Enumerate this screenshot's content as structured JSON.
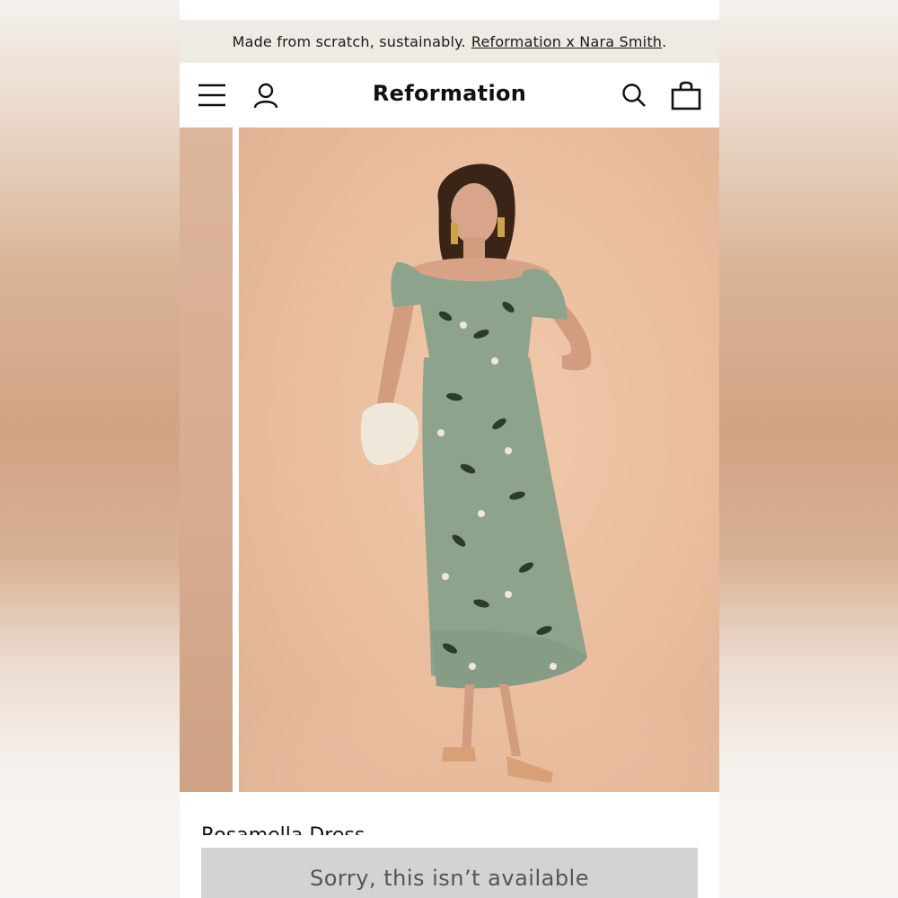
{
  "promo": {
    "text": "Made from scratch, sustainably.",
    "link": "Reformation x Nara Smith",
    "trailing": "."
  },
  "header": {
    "logo": "Reformation",
    "icons": [
      "menu-icon",
      "account-icon",
      "search-icon",
      "bag-icon"
    ]
  },
  "gallery": {
    "image_alt": "Model wearing green floral off-shoulder midi dress"
  },
  "product": {
    "title_partial": "Rosamella Dress"
  },
  "cta": {
    "label": "Sorry, this isn’t available"
  },
  "colors": {
    "promo_bg": "#eeebe4",
    "slide_bg": "#e9bd9d",
    "dress": "#8fa38c",
    "button_bg": "#d3d3d3"
  }
}
